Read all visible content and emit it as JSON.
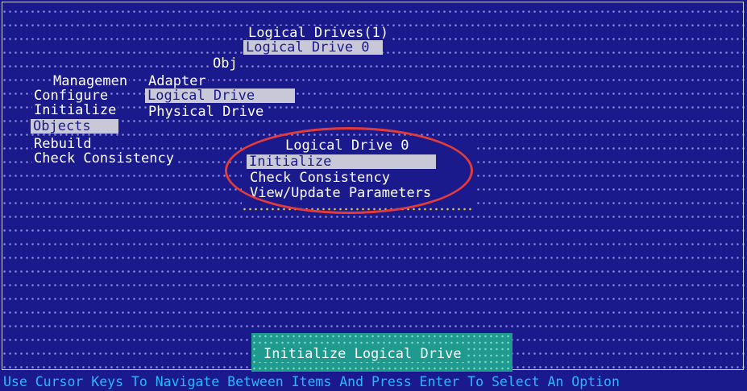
{
  "header": {
    "logical_drives_title": "Logical Drives(1)",
    "logical_drive_item": "Logical Drive 0",
    "obj_label": "Obj"
  },
  "main_menu": {
    "items": [
      {
        "label": "Managemen"
      },
      {
        "label": "Configure"
      },
      {
        "label": "Initialize"
      },
      {
        "label": "Objects"
      },
      {
        "label": "Rebuild"
      },
      {
        "label": "Check Consistency"
      }
    ],
    "selected": "Objects"
  },
  "objects_menu": {
    "items": [
      {
        "label": "Adapter"
      },
      {
        "label": "Logical Drive"
      },
      {
        "label": "Physical Drive"
      }
    ],
    "selected": "Logical Drive"
  },
  "submenu": {
    "title": "Logical Drive 0",
    "items": [
      {
        "label": "Initialize"
      },
      {
        "label": "Check Consistency"
      },
      {
        "label": "View/Update Parameters"
      }
    ],
    "selected": "Initialize"
  },
  "status_box": {
    "text": "Initialize Logical Drive"
  },
  "footer": {
    "hint": "Use Cursor Keys To Navigate Between Items And Press Enter To Select An Option"
  },
  "colors": {
    "background": "#1a1a8c",
    "highlight": "#c8c8d8",
    "status_box": "#1e9a8e",
    "footer_text": "#2ab7ff",
    "annotation": "#e23b3b"
  }
}
